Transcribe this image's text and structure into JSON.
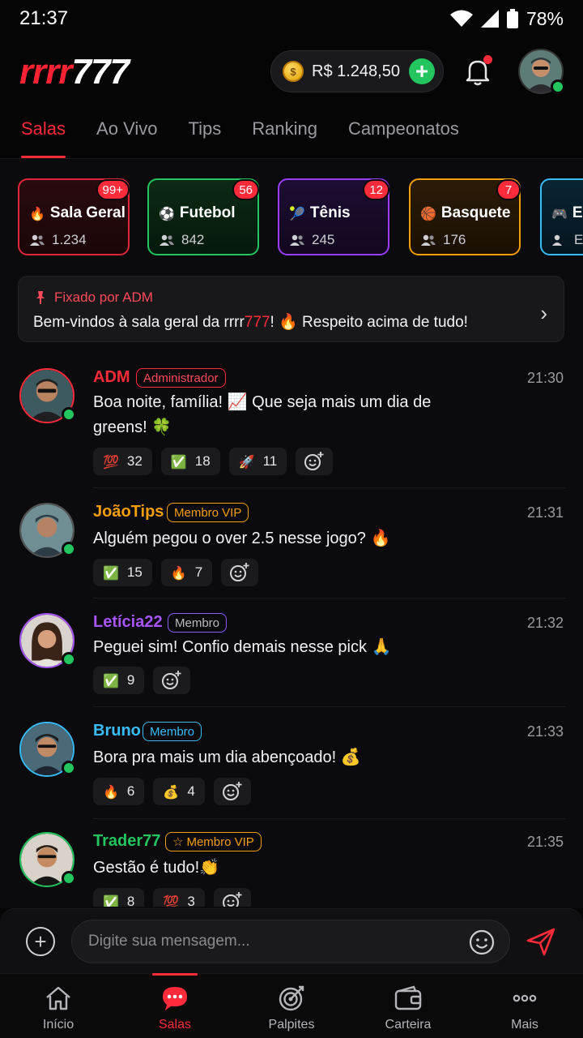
{
  "status_bar": {
    "time": "21:37",
    "battery": "78%"
  },
  "header": {
    "logo_red": "rrrr",
    "logo_white": "777",
    "balance": "R$ 1.248,50"
  },
  "tabs": [
    "Salas",
    "Ao Vivo",
    "Tips",
    "Ranking",
    "Campeonatos"
  ],
  "rooms": [
    {
      "emoji": "🔥",
      "name": "Sala Geral",
      "count": "1.234",
      "badge": "99+"
    },
    {
      "emoji": "⚽",
      "name": "Futebol",
      "count": "842",
      "badge": "56"
    },
    {
      "emoji": "🎾",
      "name": "Tênis",
      "count": "245",
      "badge": "12"
    },
    {
      "emoji": "🏀",
      "name": "Basquete",
      "count": "176",
      "badge": "7"
    },
    {
      "emoji": "🎮",
      "name": "E-",
      "count": "E",
      "badge": ""
    }
  ],
  "pinned": {
    "by": "Fixado por ADM",
    "text_before": "Bem-vindos à sala geral da rrrr",
    "text_red": "777",
    "text_after": "! 🔥 Respeito acima de tudo!"
  },
  "messages": [
    {
      "user": "ADM",
      "role": "Administrador",
      "time": "21:30",
      "text": "Boa noite, família! 📈 Que seja mais um dia de greens! 🍀",
      "reactions": [
        {
          "emoji": "💯",
          "count": "32"
        },
        {
          "emoji": "✅",
          "count": "18"
        },
        {
          "emoji": "🚀",
          "count": "11"
        }
      ]
    },
    {
      "user": "JoãoTips",
      "role": "Membro VIP",
      "time": "21:31",
      "text": "Alguém pegou o over 2.5 nesse jogo? 🔥",
      "reactions": [
        {
          "emoji": "✅",
          "count": "15"
        },
        {
          "emoji": "🔥",
          "count": "7"
        }
      ]
    },
    {
      "user": "Letícia22",
      "role": "Membro",
      "time": "21:32",
      "text": "Peguei sim! Confio demais nesse pick 🙏",
      "reactions": [
        {
          "emoji": "✅",
          "count": "9"
        }
      ]
    },
    {
      "user": "Bruno",
      "role": "Membro",
      "time": "21:33",
      "text": "Bora pra mais um dia abençoado! 💰",
      "reactions": [
        {
          "emoji": "🔥",
          "count": "6"
        },
        {
          "emoji": "💰",
          "count": "4"
        }
      ]
    },
    {
      "user": "Trader77",
      "role": "Membro VIP",
      "role_icon": "☆",
      "time": "21:35",
      "text": "Gestão é tudo!👏",
      "reactions": [
        {
          "emoji": "✅",
          "count": "8"
        },
        {
          "emoji": "💯",
          "count": "3"
        }
      ]
    }
  ],
  "input": {
    "placeholder": "Digite sua mensagem..."
  },
  "bottom_nav": [
    "Início",
    "Salas",
    "Palpites",
    "Carteira",
    "Mais"
  ],
  "colors": {
    "accent": "#ff2a3a",
    "online": "#22c55e",
    "vip": "#f59e0b",
    "member_purple": "#a855f7",
    "member_blue": "#38bdf8"
  }
}
